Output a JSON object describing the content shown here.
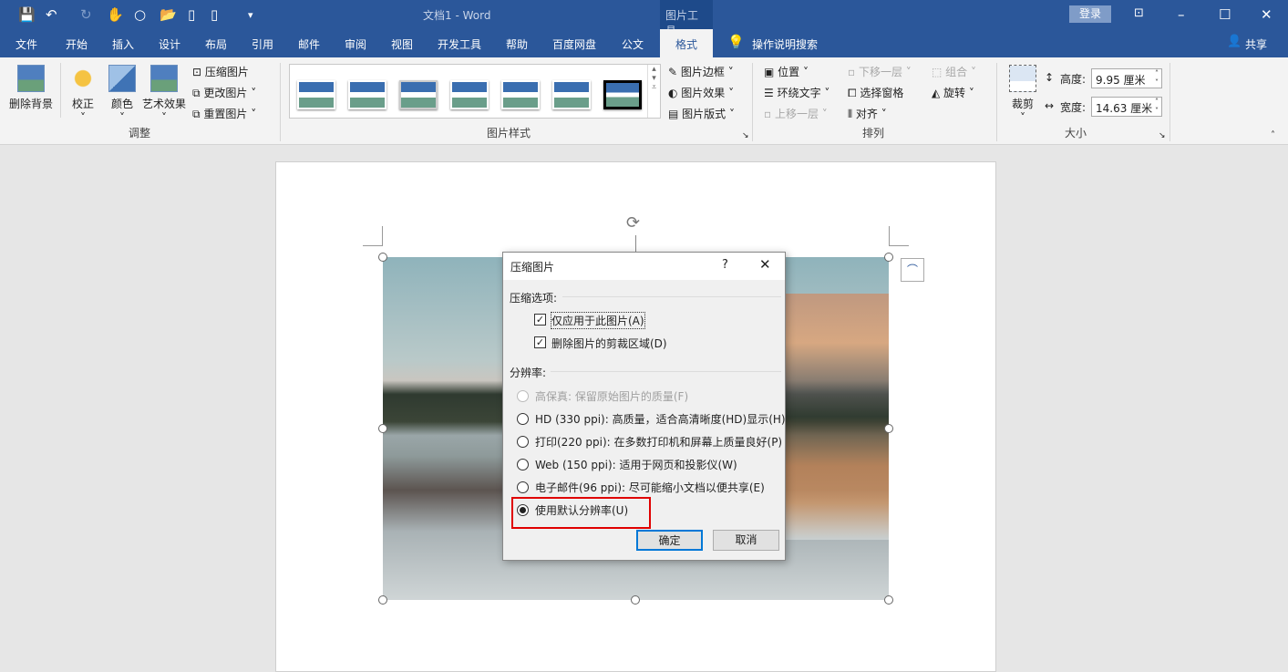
{
  "titlebar": {
    "doc_title": "文档1  -  Word",
    "context_tab": "图片工具",
    "login": "登录"
  },
  "tabs": [
    "文件",
    "开始",
    "插入",
    "设计",
    "布局",
    "引用",
    "邮件",
    "审阅",
    "视图",
    "开发工具",
    "帮助",
    "百度网盘",
    "公文",
    "格式"
  ],
  "search": "操作说明搜索",
  "share": "共享",
  "ribbon": {
    "adjust": {
      "label": "调整",
      "remove_bg": "删除背景",
      "correct": "校正",
      "color": "颜色",
      "art": "艺术效果",
      "compress": "压缩图片",
      "change": "更改图片",
      "reset": "重置图片"
    },
    "styles": {
      "label": "图片样式",
      "border": "图片边框",
      "effects": "图片效果",
      "layout": "图片版式"
    },
    "arrange": {
      "label": "排列",
      "position": "位置",
      "wrap": "环绕文字",
      "forward": "上移一层",
      "backward": "下移一层",
      "pane": "选择窗格",
      "align": "对齐",
      "group": "组合",
      "rotate": "旋转"
    },
    "size": {
      "label": "大小",
      "crop": "裁剪",
      "height_label": "高度:",
      "height": "9.95 厘米",
      "width_label": "宽度:",
      "width": "14.63 厘米"
    }
  },
  "dialog": {
    "title": "压缩图片",
    "help": "?",
    "options_label": "压缩选项:",
    "cb1": "仅应用于此图片(A)",
    "cb2": "删除图片的剪裁区域(D)",
    "res_label": "分辨率:",
    "radios": [
      "高保真: 保留原始图片的质量(F)",
      "HD (330 ppi): 高质量，适合高清晰度(HD)显示(H)",
      "打印(220 ppi): 在多数打印机和屏幕上质量良好(P)",
      "Web (150 ppi): 适用于网页和投影仪(W)",
      "电子邮件(96 ppi): 尽可能缩小文档以便共享(E)",
      "使用默认分辨率(U)"
    ],
    "selected": 5,
    "ok": "确定",
    "cancel": "取消"
  },
  "colors": {
    "brand": "#2b579a",
    "highlight": "#e00000"
  }
}
